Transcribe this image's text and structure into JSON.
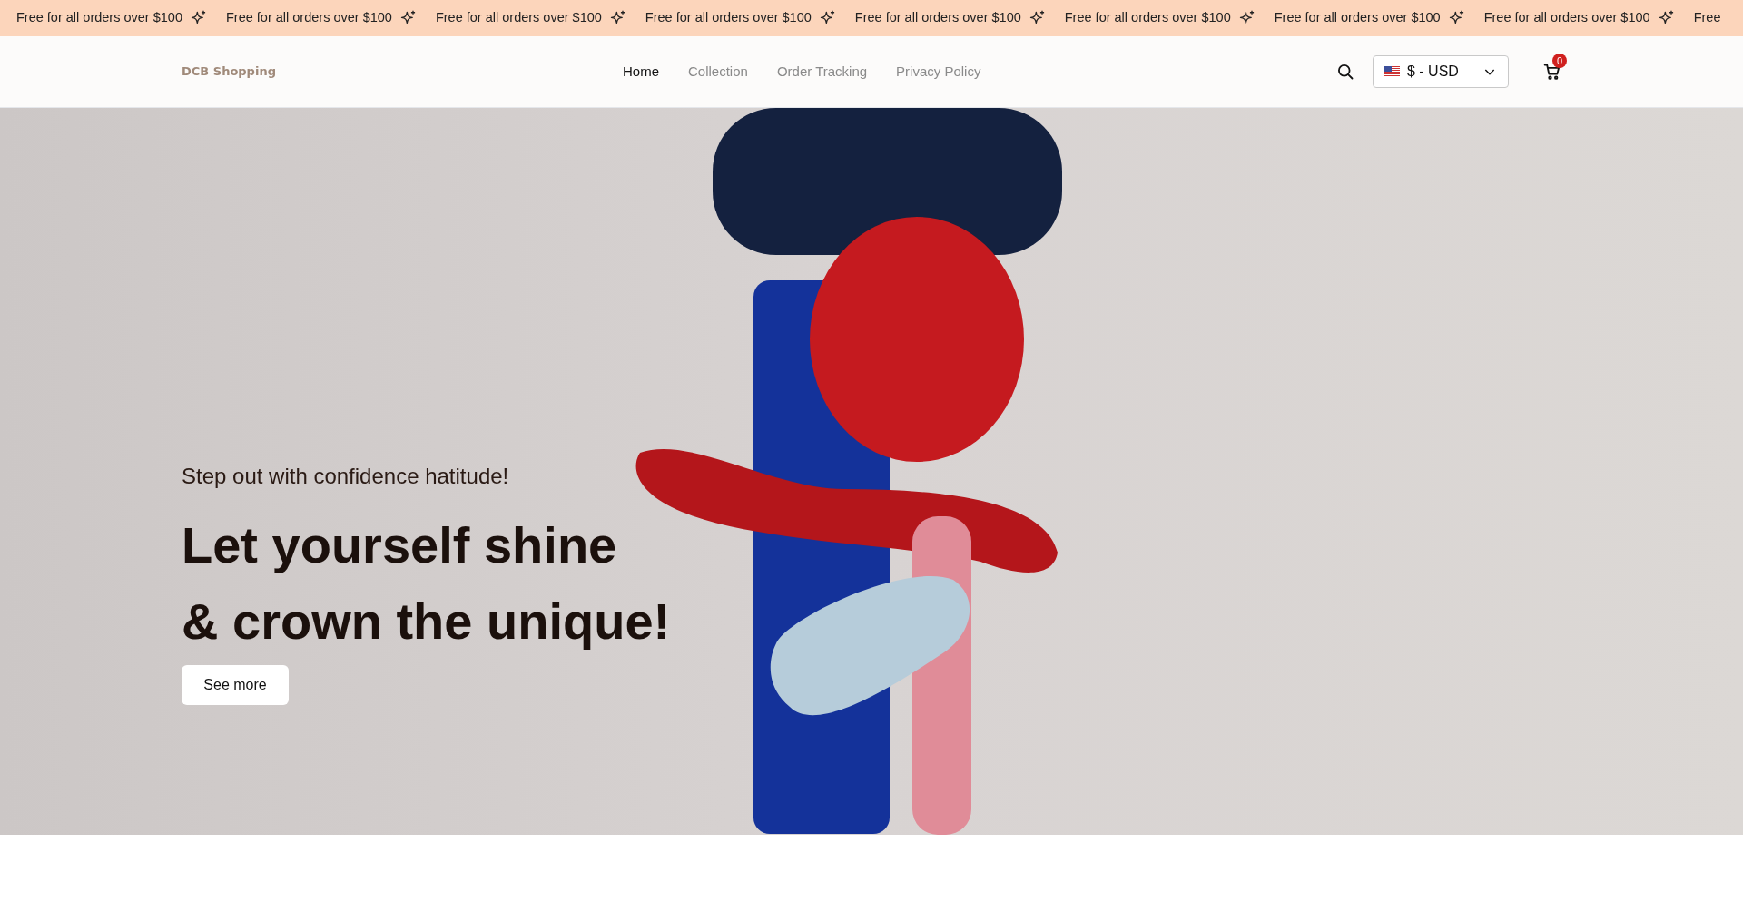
{
  "announcement": {
    "items": [
      {
        "text": "Free for all orders over $100",
        "icon": true
      },
      {
        "text": "Free for all orders over $100",
        "icon": true
      },
      {
        "text": "Free for all orders over $100",
        "icon": true
      },
      {
        "text": "Free for all orders over $100",
        "icon": true
      },
      {
        "text": "Free for all orders over $100",
        "icon": true
      },
      {
        "text": "Free for all orders over $100",
        "icon": true
      },
      {
        "text": "Free for all orders over $100",
        "icon": true
      },
      {
        "text": "Free for all orders over $100",
        "icon": true
      },
      {
        "text": "Free",
        "icon": false
      }
    ]
  },
  "header": {
    "logo": "DCB Shopping",
    "nav": [
      {
        "label": "Home",
        "selected": true
      },
      {
        "label": "Collection",
        "selected": false
      },
      {
        "label": "Order Tracking",
        "selected": false
      },
      {
        "label": "Privacy Policy",
        "selected": false
      }
    ],
    "currency": "$ - USD",
    "cart_count": "0"
  },
  "hero": {
    "subtitle": "Step out with confidence hatitude!",
    "title_lines": [
      "Let yourself shine",
      "& crown the unique!"
    ],
    "button": "See more"
  }
}
